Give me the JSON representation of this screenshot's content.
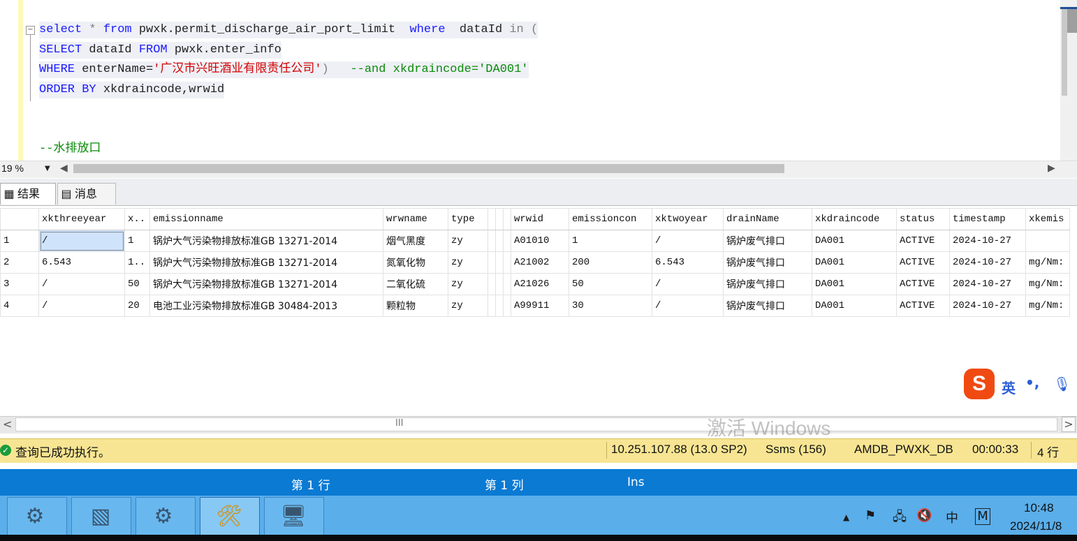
{
  "editor": {
    "lines": [
      {
        "parts": [
          [
            "kw",
            "select"
          ],
          [
            "gr",
            " * "
          ],
          [
            "kw",
            "from"
          ],
          [
            "pl",
            " pwxk.permit_discharge_air_port_limit  "
          ],
          [
            "kw",
            "where"
          ],
          [
            "pl",
            "  dataId "
          ],
          [
            "gr",
            "in ("
          ]
        ]
      },
      {
        "parts": [
          [
            "kw",
            "SELECT"
          ],
          [
            "pl",
            " dataId "
          ],
          [
            "kw",
            "FROM"
          ],
          [
            "pl",
            " pwxk.enter_info"
          ]
        ]
      },
      {
        "parts": [
          [
            "kw",
            "WHERE"
          ],
          [
            "pl",
            " enterName="
          ],
          [
            "str",
            "'广汉市兴旺酒业有限责任公司'"
          ],
          [
            "gr",
            ")"
          ],
          [
            "pl",
            "   "
          ],
          [
            "cm",
            "--and xkdraincode='DA001'"
          ]
        ]
      },
      {
        "parts": [
          [
            "kw",
            "ORDER BY"
          ],
          [
            "pl",
            " xkdraincode,wrwid"
          ]
        ]
      }
    ],
    "comment_line": "--水排放口"
  },
  "zoom": {
    "value": "19 %"
  },
  "tabs": {
    "results": "结果",
    "messages": "消息"
  },
  "grid": {
    "columns": [
      "",
      "xkthreeyear",
      "x..",
      "emissionname",
      "wrwname",
      "type",
      "",
      "",
      "",
      "wrwid",
      "emissioncon",
      "xktwoyear",
      "drainName",
      "xkdraincode",
      "status",
      "timestamp",
      "xkemis"
    ],
    "rows": [
      [
        "1",
        "/",
        "1",
        "锅炉大气污染物排放标准GB 13271-2014",
        "烟气黑度",
        "zy",
        "",
        "",
        "",
        "A01010",
        "1",
        "/",
        "锅炉废气排口",
        "DA001",
        "ACTIVE",
        "2024-10-27",
        ""
      ],
      [
        "2",
        "6.543",
        "1..",
        "锅炉大气污染物排放标准GB 13271-2014",
        "氮氧化物",
        "zy",
        "",
        "",
        "",
        "A21002",
        "200",
        "6.543",
        "锅炉废气排口",
        "DA001",
        "ACTIVE",
        "2024-10-27",
        "mg/Nm:"
      ],
      [
        "3",
        "/",
        "50",
        "锅炉大气污染物排放标准GB 13271-2014",
        "二氧化硫",
        "zy",
        "",
        "",
        "",
        "A21026",
        "50",
        "/",
        "锅炉废气排口",
        "DA001",
        "ACTIVE",
        "2024-10-27",
        "mg/Nm:"
      ],
      [
        "4",
        "/",
        "20",
        "电池工业污染物排放标准GB 30484-2013",
        "颗粒物",
        "zy",
        "",
        "",
        "",
        "A99911",
        "30",
        "/",
        "锅炉废气排口",
        "DA001",
        "ACTIVE",
        "2024-10-27",
        "mg/Nm:"
      ]
    ]
  },
  "watermark": "激活 Windows",
  "ime": {
    "logo": "S",
    "lang": "英",
    "punct": "•,",
    "mic": "🎤"
  },
  "status": {
    "message": "查询已成功执行。",
    "server": "10.251.107.88 (13.0 SP2)",
    "app": "Ssms (156)",
    "database": "AMDB_PWXK_DB",
    "elapsed": "00:00:33",
    "rows": "4 行"
  },
  "position": {
    "line": "第 1 行",
    "col": "第 1 列",
    "mode": "Ins"
  },
  "taskbar": {
    "tray": {
      "chevron": "▲",
      "ime": "中",
      "m": "M"
    },
    "clock_time": "10:48",
    "clock_date": "2024/11/8"
  },
  "colors": {
    "keyword": "#1a1aff",
    "string": "#d40000",
    "comment": "#0a8a0a",
    "status_bg": "#f7e593",
    "blue_bar": "#0a7ad3",
    "taskbar": "#5aaeea"
  }
}
